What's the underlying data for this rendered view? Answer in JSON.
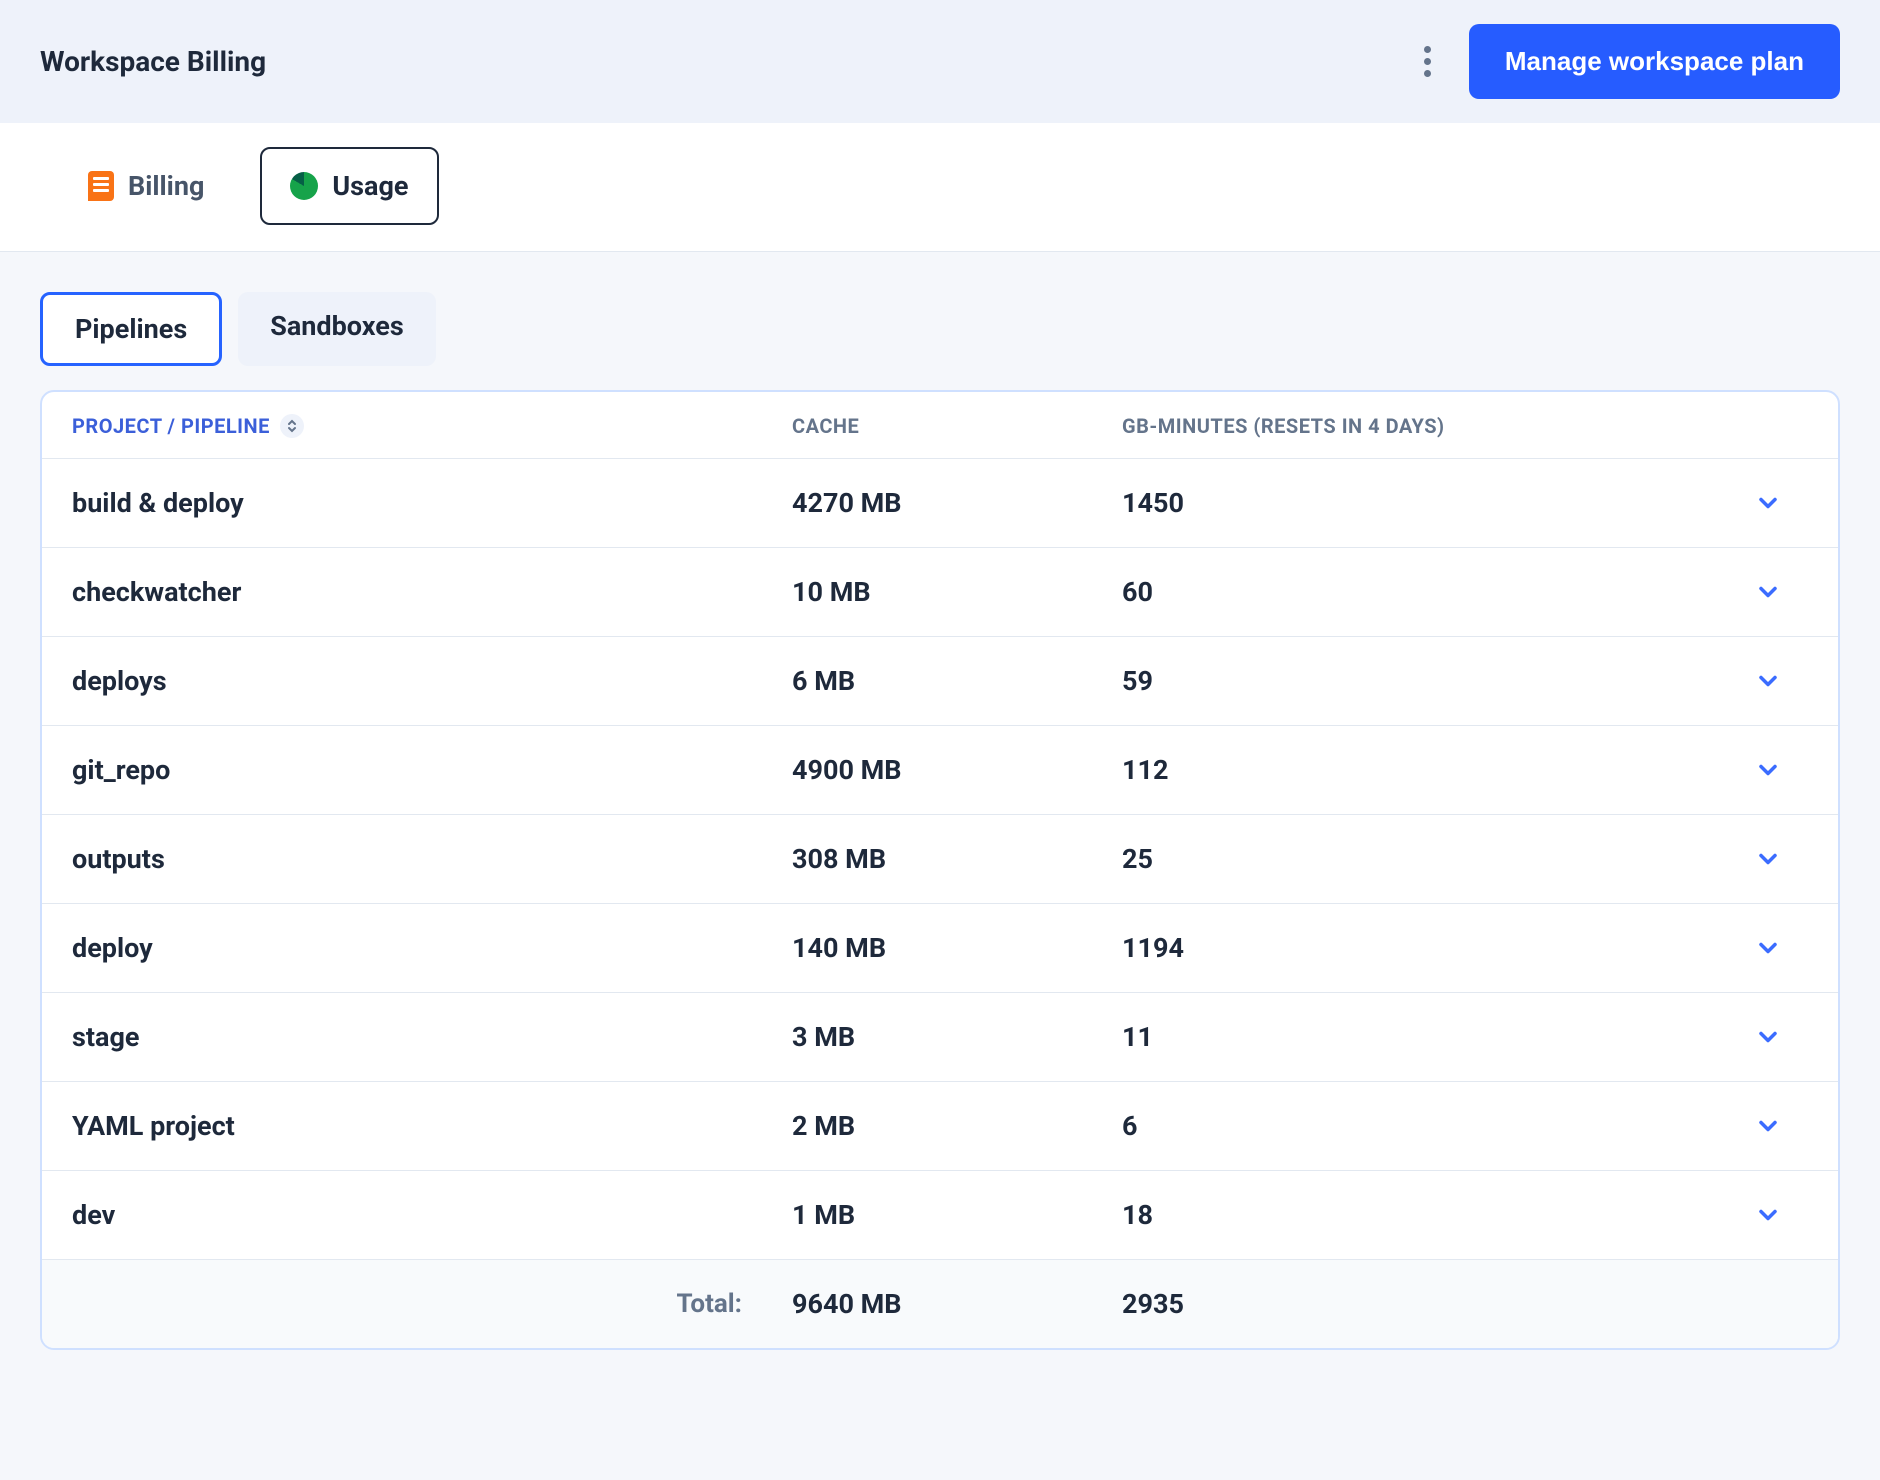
{
  "header": {
    "title": "Workspace Billing",
    "manage_button": "Manage workspace plan"
  },
  "section_tabs": {
    "billing": "Billing",
    "usage": "Usage"
  },
  "subtabs": {
    "pipelines": "Pipelines",
    "sandboxes": "Sandboxes"
  },
  "table": {
    "columns": {
      "project": "Project / Pipeline",
      "cache": "Cache",
      "gbmin": "GB-minutes (resets in 4 days)"
    },
    "rows": [
      {
        "name": "build & deploy",
        "cache": "4270 MB",
        "gbmin": "1450"
      },
      {
        "name": "checkwatcher",
        "cache": "10 MB",
        "gbmin": "60"
      },
      {
        "name": "deploys",
        "cache": "6 MB",
        "gbmin": "59"
      },
      {
        "name": "git_repo",
        "cache": "4900 MB",
        "gbmin": "112"
      },
      {
        "name": "outputs",
        "cache": "308 MB",
        "gbmin": "25"
      },
      {
        "name": "deploy",
        "cache": "140 MB",
        "gbmin": "1194"
      },
      {
        "name": "stage",
        "cache": "3 MB",
        "gbmin": "11"
      },
      {
        "name": "YAML project",
        "cache": "2 MB",
        "gbmin": "6"
      },
      {
        "name": "dev",
        "cache": "1 MB",
        "gbmin": "18"
      }
    ],
    "footer": {
      "label": "Total:",
      "cache": "9640 MB",
      "gbmin": "2935"
    }
  }
}
